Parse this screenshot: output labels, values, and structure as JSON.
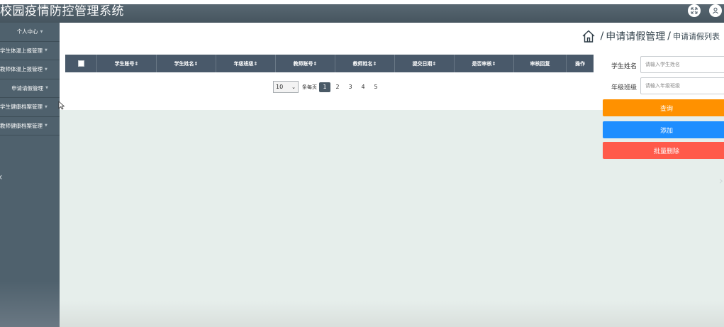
{
  "app": {
    "title": "校园疫情防控管理系统"
  },
  "header": {
    "icons": [
      "fullscreen-icon",
      "user-icon"
    ]
  },
  "sidebar": {
    "items": [
      {
        "label": "个人中心"
      },
      {
        "label": "学生体温上报管理"
      },
      {
        "label": "教师体温上报管理"
      },
      {
        "label": "申请请假管理"
      },
      {
        "label": "学生健康档案管理"
      },
      {
        "label": "教师健康档案管理"
      }
    ]
  },
  "breadcrumb": {
    "level1": "申请请假管理",
    "level2": "申请请假列表"
  },
  "table": {
    "columns": [
      "学生账号",
      "学生姓名",
      "年级班级",
      "教师账号",
      "教师姓名",
      "提交日期",
      "是否审核",
      "审核回复",
      "操作"
    ],
    "sortable": [
      true,
      true,
      true,
      true,
      true,
      true,
      true,
      false,
      false
    ]
  },
  "pagination": {
    "page_size": "10",
    "per_page_label": "条每页",
    "pages": [
      "1",
      "2",
      "3",
      "4",
      "5"
    ],
    "current": "1"
  },
  "search": {
    "student_name_label": "学生姓名",
    "student_name_placeholder": "请输入学生姓名",
    "class_label": "年级班级",
    "class_placeholder": "请输入年级班级"
  },
  "buttons": {
    "query": "查询",
    "add": "添加",
    "batch_delete": "批量删除"
  },
  "colors": {
    "header_bg": "#4f5e69",
    "sidebar_bg": "#4f616d",
    "table_head_bg": "#49596a",
    "query_btn": "#ff9100",
    "add_btn": "#1e8eff",
    "delete_btn": "#ff5a4a",
    "content_bg": "#e6eeeb"
  }
}
